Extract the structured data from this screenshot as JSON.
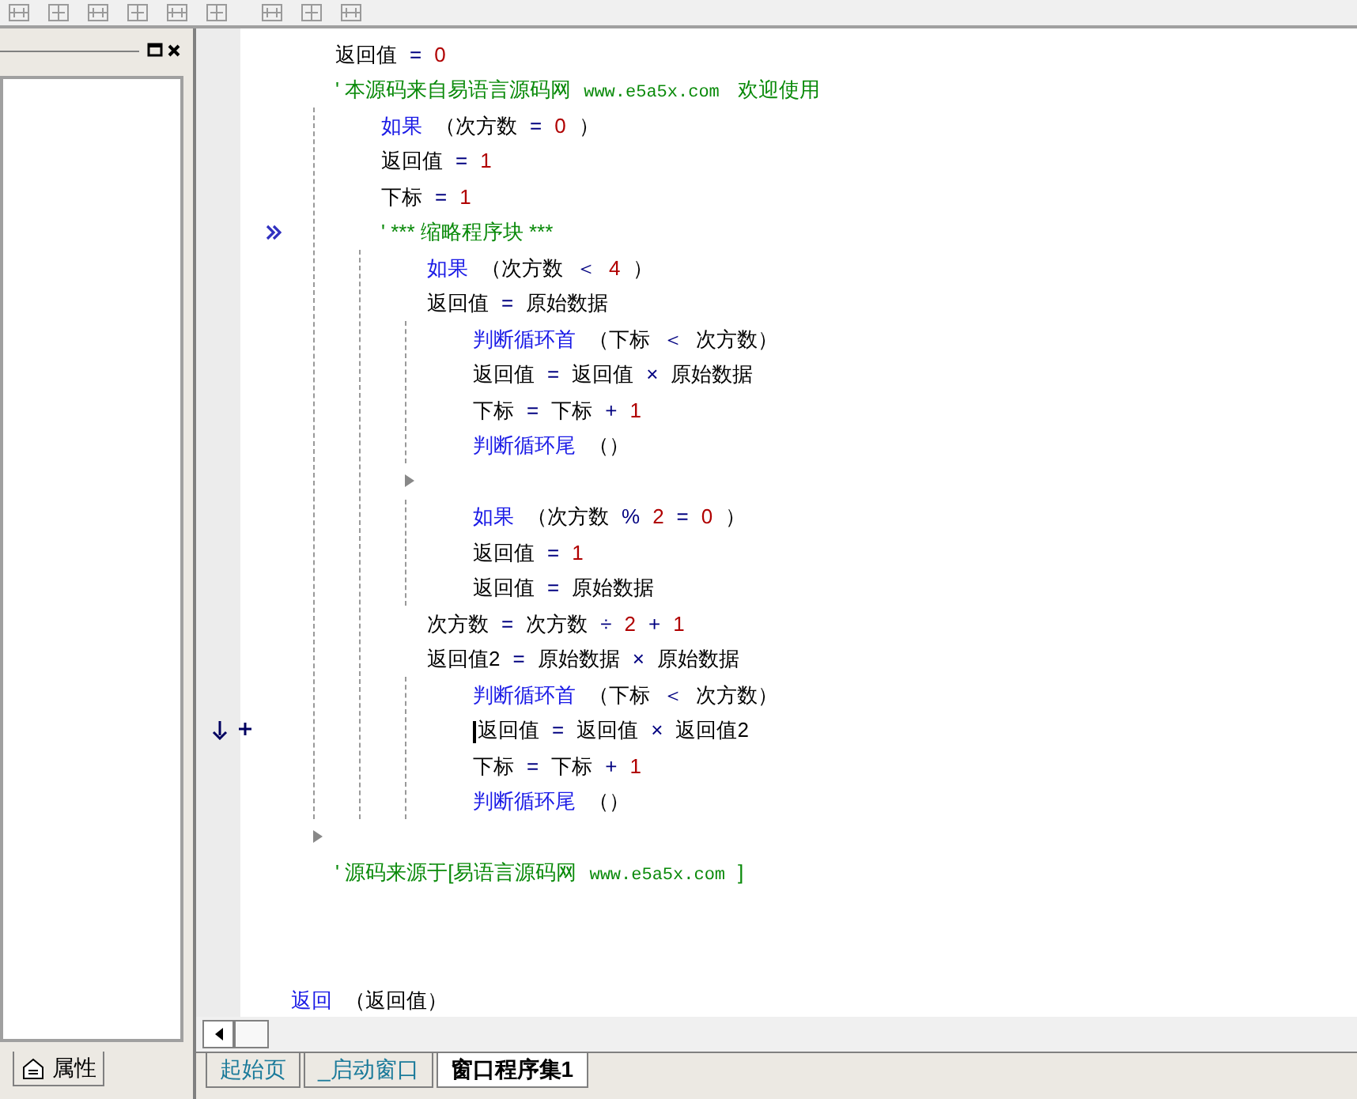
{
  "left_panel": {
    "tab": {
      "label": "属性",
      "selected": false
    }
  },
  "code": [
    {
      "kind": "line",
      "tokens": [
        {
          "kind": "text",
          "text": "返回值"
        },
        {
          "kind": "op",
          "text": "="
        },
        {
          "kind": "num",
          "text": "0"
        }
      ]
    },
    {
      "kind": "line",
      "tokens": [
        {
          "kind": "comment",
          "text": "' 本源码来自易语言源码网"
        },
        {
          "kind": "url",
          "text": "www.e5a5x.com"
        },
        {
          "kind": "comment",
          "text": " 欢迎使用"
        }
      ],
      "children": [
        {
          "kind": "line",
          "tokens": [
            {
              "kind": "kw",
              "text": "如果"
            },
            {
              "kind": "text",
              "text": "（次方数"
            },
            {
              "kind": "op",
              "text": "="
            },
            {
              "kind": "num",
              "text": "0"
            },
            {
              "kind": "text",
              "text": "）"
            }
          ]
        },
        {
          "kind": "line",
          "tokens": [
            {
              "kind": "text",
              "text": "返回值"
            },
            {
              "kind": "op",
              "text": "="
            },
            {
              "kind": "num",
              "text": "1"
            }
          ]
        },
        {
          "kind": "line",
          "tokens": [
            {
              "kind": "text",
              "text": "下标"
            },
            {
              "kind": "op",
              "text": "="
            },
            {
              "kind": "num",
              "text": "1"
            }
          ]
        },
        {
          "kind": "line",
          "collapsed": true,
          "tokens": [
            {
              "kind": "comment",
              "text": "' *** 缩略程序块 ***"
            }
          ],
          "children": [
            {
              "kind": "line",
              "tokens": [
                {
                  "kind": "kw",
                  "text": "如果"
                },
                {
                  "kind": "text",
                  "text": "（次方数"
                },
                {
                  "kind": "op",
                  "text": "＜"
                },
                {
                  "kind": "num",
                  "text": "4"
                },
                {
                  "kind": "text",
                  "text": "）"
                }
              ]
            },
            {
              "kind": "line",
              "tokens": [
                {
                  "kind": "text",
                  "text": "返回值"
                },
                {
                  "kind": "op",
                  "text": "="
                },
                {
                  "kind": "text",
                  "text": "原始数据"
                }
              ],
              "children": [
                {
                  "kind": "line",
                  "tokens": [
                    {
                      "kind": "kw",
                      "text": "判断循环首"
                    },
                    {
                      "kind": "text",
                      "text": "（下标"
                    },
                    {
                      "kind": "op",
                      "text": "＜"
                    },
                    {
                      "kind": "text",
                      "text": "次方数）"
                    }
                  ]
                },
                {
                  "kind": "line",
                  "tokens": [
                    {
                      "kind": "text",
                      "text": "返回值"
                    },
                    {
                      "kind": "op",
                      "text": "="
                    },
                    {
                      "kind": "text",
                      "text": "返回值"
                    },
                    {
                      "kind": "op",
                      "text": "×"
                    },
                    {
                      "kind": "text",
                      "text": "原始数据"
                    }
                  ]
                },
                {
                  "kind": "line",
                  "tokens": [
                    {
                      "kind": "text",
                      "text": "下标"
                    },
                    {
                      "kind": "op",
                      "text": "="
                    },
                    {
                      "kind": "text",
                      "text": "下标"
                    },
                    {
                      "kind": "op",
                      "text": "+"
                    },
                    {
                      "kind": "num",
                      "text": "1"
                    }
                  ]
                },
                {
                  "kind": "line",
                  "tokens": [
                    {
                      "kind": "kw",
                      "text": "判断循环尾"
                    },
                    {
                      "kind": "text",
                      "text": "（）"
                    }
                  ]
                }
              ]
            },
            {
              "kind": "empty",
              "children": [
                {
                  "kind": "line",
                  "tokens": [
                    {
                      "kind": "kw",
                      "text": "如果"
                    },
                    {
                      "kind": "text",
                      "text": "（次方数"
                    },
                    {
                      "kind": "op",
                      "text": "%"
                    },
                    {
                      "kind": "num",
                      "text": "2"
                    },
                    {
                      "kind": "op",
                      "text": "="
                    },
                    {
                      "kind": "num",
                      "text": "0"
                    },
                    {
                      "kind": "text",
                      "text": "）"
                    }
                  ]
                },
                {
                  "kind": "line",
                  "tokens": [
                    {
                      "kind": "text",
                      "text": "返回值"
                    },
                    {
                      "kind": "op",
                      "text": "="
                    },
                    {
                      "kind": "num",
                      "text": "1"
                    }
                  ]
                },
                {
                  "kind": "line",
                  "tokens": [
                    {
                      "kind": "text",
                      "text": "返回值"
                    },
                    {
                      "kind": "op",
                      "text": "="
                    },
                    {
                      "kind": "text",
                      "text": "原始数据"
                    }
                  ]
                }
              ]
            },
            {
              "kind": "line",
              "tokens": [
                {
                  "kind": "text",
                  "text": "次方数"
                },
                {
                  "kind": "op",
                  "text": "="
                },
                {
                  "kind": "text",
                  "text": "次方数"
                },
                {
                  "kind": "op",
                  "text": "÷"
                },
                {
                  "kind": "num",
                  "text": "2"
                },
                {
                  "kind": "op",
                  "text": "+"
                },
                {
                  "kind": "num",
                  "text": "1"
                }
              ]
            },
            {
              "kind": "line",
              "tokens": [
                {
                  "kind": "text",
                  "text": "返回值2"
                },
                {
                  "kind": "op",
                  "text": "="
                },
                {
                  "kind": "text",
                  "text": "原始数据"
                },
                {
                  "kind": "op",
                  "text": "×"
                },
                {
                  "kind": "text",
                  "text": "原始数据"
                }
              ],
              "children": [
                {
                  "kind": "line",
                  "tokens": [
                    {
                      "kind": "kw",
                      "text": "判断循环首"
                    },
                    {
                      "kind": "text",
                      "text": "（下标"
                    },
                    {
                      "kind": "op",
                      "text": "＜"
                    },
                    {
                      "kind": "text",
                      "text": "次方数）"
                    }
                  ]
                },
                {
                  "kind": "line",
                  "cursor": true,
                  "caret": true,
                  "tokens": [
                    {
                      "kind": "text",
                      "text": "返回值"
                    },
                    {
                      "kind": "op",
                      "text": "="
                    },
                    {
                      "kind": "text",
                      "text": "返回值"
                    },
                    {
                      "kind": "op",
                      "text": "×"
                    },
                    {
                      "kind": "text",
                      "text": "返回值2"
                    }
                  ]
                },
                {
                  "kind": "line",
                  "tokens": [
                    {
                      "kind": "text",
                      "text": "下标"
                    },
                    {
                      "kind": "op",
                      "text": "="
                    },
                    {
                      "kind": "text",
                      "text": "下标"
                    },
                    {
                      "kind": "op",
                      "text": "+"
                    },
                    {
                      "kind": "num",
                      "text": "1"
                    }
                  ]
                },
                {
                  "kind": "line",
                  "tokens": [
                    {
                      "kind": "kw",
                      "text": "判断循环尾"
                    },
                    {
                      "kind": "text",
                      "text": "（）"
                    }
                  ]
                }
              ]
            }
          ]
        }
      ]
    },
    {
      "kind": "empty"
    },
    {
      "kind": "line",
      "tokens": [
        {
          "kind": "comment",
          "text": "' 源码来源于[易语言源码网"
        },
        {
          "kind": "url",
          "text": "www.e5a5x.com"
        },
        {
          "kind": "comment",
          "text": "]"
        }
      ]
    }
  ],
  "return_line": {
    "tokens": [
      {
        "kind": "kw",
        "text": "返回"
      },
      {
        "kind": "text",
        "text": "（返回值）"
      }
    ]
  },
  "tabs": [
    {
      "label": "起始页",
      "selected": false
    },
    {
      "label": "_启动窗口",
      "selected": false
    },
    {
      "label": "窗口程序集1",
      "selected": true
    }
  ]
}
